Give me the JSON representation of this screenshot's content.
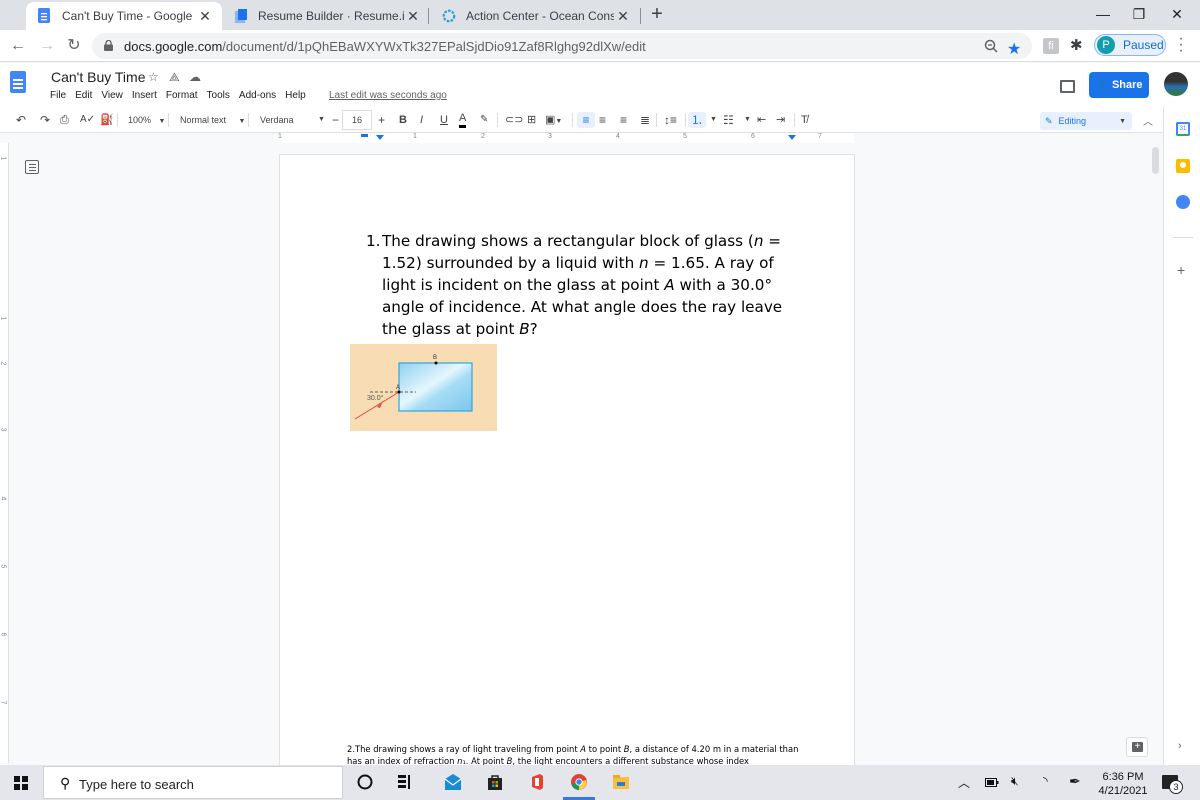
{
  "browser": {
    "tabs": [
      {
        "title": "Can't Buy Time - Google Docs",
        "active": true,
        "favicon": "google-docs-icon"
      },
      {
        "title": "Resume Builder · Resume.io",
        "active": false,
        "favicon": "resume-io-icon"
      },
      {
        "title": "Action Center - Ocean Conservan",
        "active": false,
        "favicon": "ocean-conservancy-icon"
      }
    ],
    "close_glyph": "✕",
    "new_tab_glyph": "+",
    "window_controls": {
      "minimize": "—",
      "restore": "❐",
      "close": "✕"
    },
    "url_host": "docs.google.com",
    "url_path": "/document/d/1pQhEBaWXYWxTk327EPalSjdDio91Zaf8Rlghg92dlXw/edit",
    "profile_initial": "P",
    "profile_status": "Paused",
    "extension_letter": "fi"
  },
  "docs": {
    "title": "Can't Buy Time",
    "menu": [
      "File",
      "Edit",
      "View",
      "Insert",
      "Format",
      "Tools",
      "Add-ons",
      "Help"
    ],
    "last_edit": "Last edit was seconds ago",
    "share_label": "Share",
    "toolbar": {
      "zoom": "100%",
      "style": "Normal text",
      "font": "Verdana",
      "font_size": "16",
      "minus": "−",
      "plus": "+",
      "bold": "B",
      "italic": "I",
      "underline": "U",
      "text_color": "A",
      "mode": "Editing"
    },
    "ruler": {
      "horizontal": [
        "1",
        "1",
        "2",
        "3",
        "4",
        "5",
        "6",
        "7"
      ],
      "vertical": [
        "1",
        "1",
        "2",
        "3",
        "4",
        "5",
        "6",
        "7",
        "8"
      ]
    },
    "content": {
      "q1_number": "1.",
      "q1_text_parts": [
        "The drawing shows a rectangular block of glass (",
        "n",
        " = 1.52) surrounded by a liquid with ",
        "n",
        " = 1.65. A ray of light is incident on the glass at point ",
        "A",
        " with a 30.0° angle of incidence. At what angle does the ray leave the glass at point ",
        "B",
        "?"
      ],
      "figure": {
        "label_a": "A",
        "label_b": "B",
        "angle_label": "30.0°",
        "colors": {
          "background": "#f8dcb3",
          "glass": "#a9dcf5",
          "ray": "#e8483f"
        }
      },
      "q2_parts": [
        "2.The drawing shows a ray of light traveling from point ",
        "A",
        " to point ",
        "B",
        ", a distance of 4.20 m in a material than has an index of refraction ",
        "n",
        "₁. At point ",
        "B",
        ", the light encounters a different substance whose index"
      ]
    }
  },
  "taskbar": {
    "search_placeholder": "Type here to search",
    "time": "6:36 PM",
    "date": "4/21/2021",
    "notification_count": "3"
  },
  "colors": {
    "accent": "#1a73e8",
    "docs_blue": "#4285f4"
  }
}
